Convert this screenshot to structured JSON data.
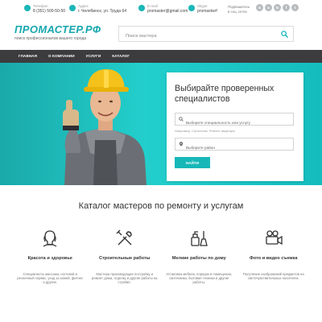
{
  "topbar": {
    "phone": {
      "label": "Телефон",
      "value": "8 (351) 500-50-50"
    },
    "address": {
      "label": "Адрес",
      "value": "г. Челябинск, ул. Труда 64"
    },
    "email": {
      "label": "E-mail",
      "value": "promaster@gmail.com"
    },
    "skype": {
      "label": "Skype",
      "value": "promastwrf"
    },
    "subscribe": {
      "line1": "Подпишитесь",
      "line2": "в соц. сетях"
    },
    "socials": [
      {
        "icon": "vk-icon",
        "glyph": "в"
      },
      {
        "icon": "odnoklassniki-icon",
        "glyph": "о"
      },
      {
        "icon": "google-plus-icon",
        "glyph": "G"
      },
      {
        "icon": "facebook-icon",
        "glyph": "f"
      },
      {
        "icon": "twitter-icon",
        "glyph": "t"
      }
    ]
  },
  "header": {
    "logo_title": "ПРОМАСТЕР.РФ",
    "logo_subtitle": "поиск профессионалов вашего города",
    "search_placeholder": "Поиск мастера"
  },
  "nav": {
    "items": [
      "ГЛАВНАЯ",
      "О КОМПАНИИ",
      "УСЛУГИ",
      "КАТАЛОГ"
    ]
  },
  "hero": {
    "title": "Выбирайте проверенных специалистов",
    "field1_placeholder": "Выберите специальность или услугу",
    "example": "Например: Сантехник, Ремонт квартиры",
    "field2_placeholder": "Выберите район",
    "button": "НАЙТИ"
  },
  "catalog": {
    "title": "Каталог мастеров по ремонту и услугам",
    "items": [
      {
        "icon": "beauty-icon",
        "name": "Красота и здоровье",
        "desc": "Специалисты массажа, ногтевой и ресничный сервис, уход за кожей, фитнес и другие."
      },
      {
        "icon": "tools-icon",
        "name": "Строительные работы",
        "desc": "Мастера производящие постройку и ремонт дома, отделку и другие работы на стройке."
      },
      {
        "icon": "cleaning-icon",
        "name": "Мелкие работы по дому",
        "desc": "Установка мебели, порядок в помещении, сантехника, бытовая техника и другие работы."
      },
      {
        "icon": "camera-icon",
        "name": "Фото и видео съемка",
        "desc": "Получение изображений предметов на светочувствительных носителях."
      }
    ]
  },
  "colors": {
    "accent": "#17b7b8",
    "nav_bg": "#3c3c3f",
    "hero_bg": "#18c2c1"
  }
}
